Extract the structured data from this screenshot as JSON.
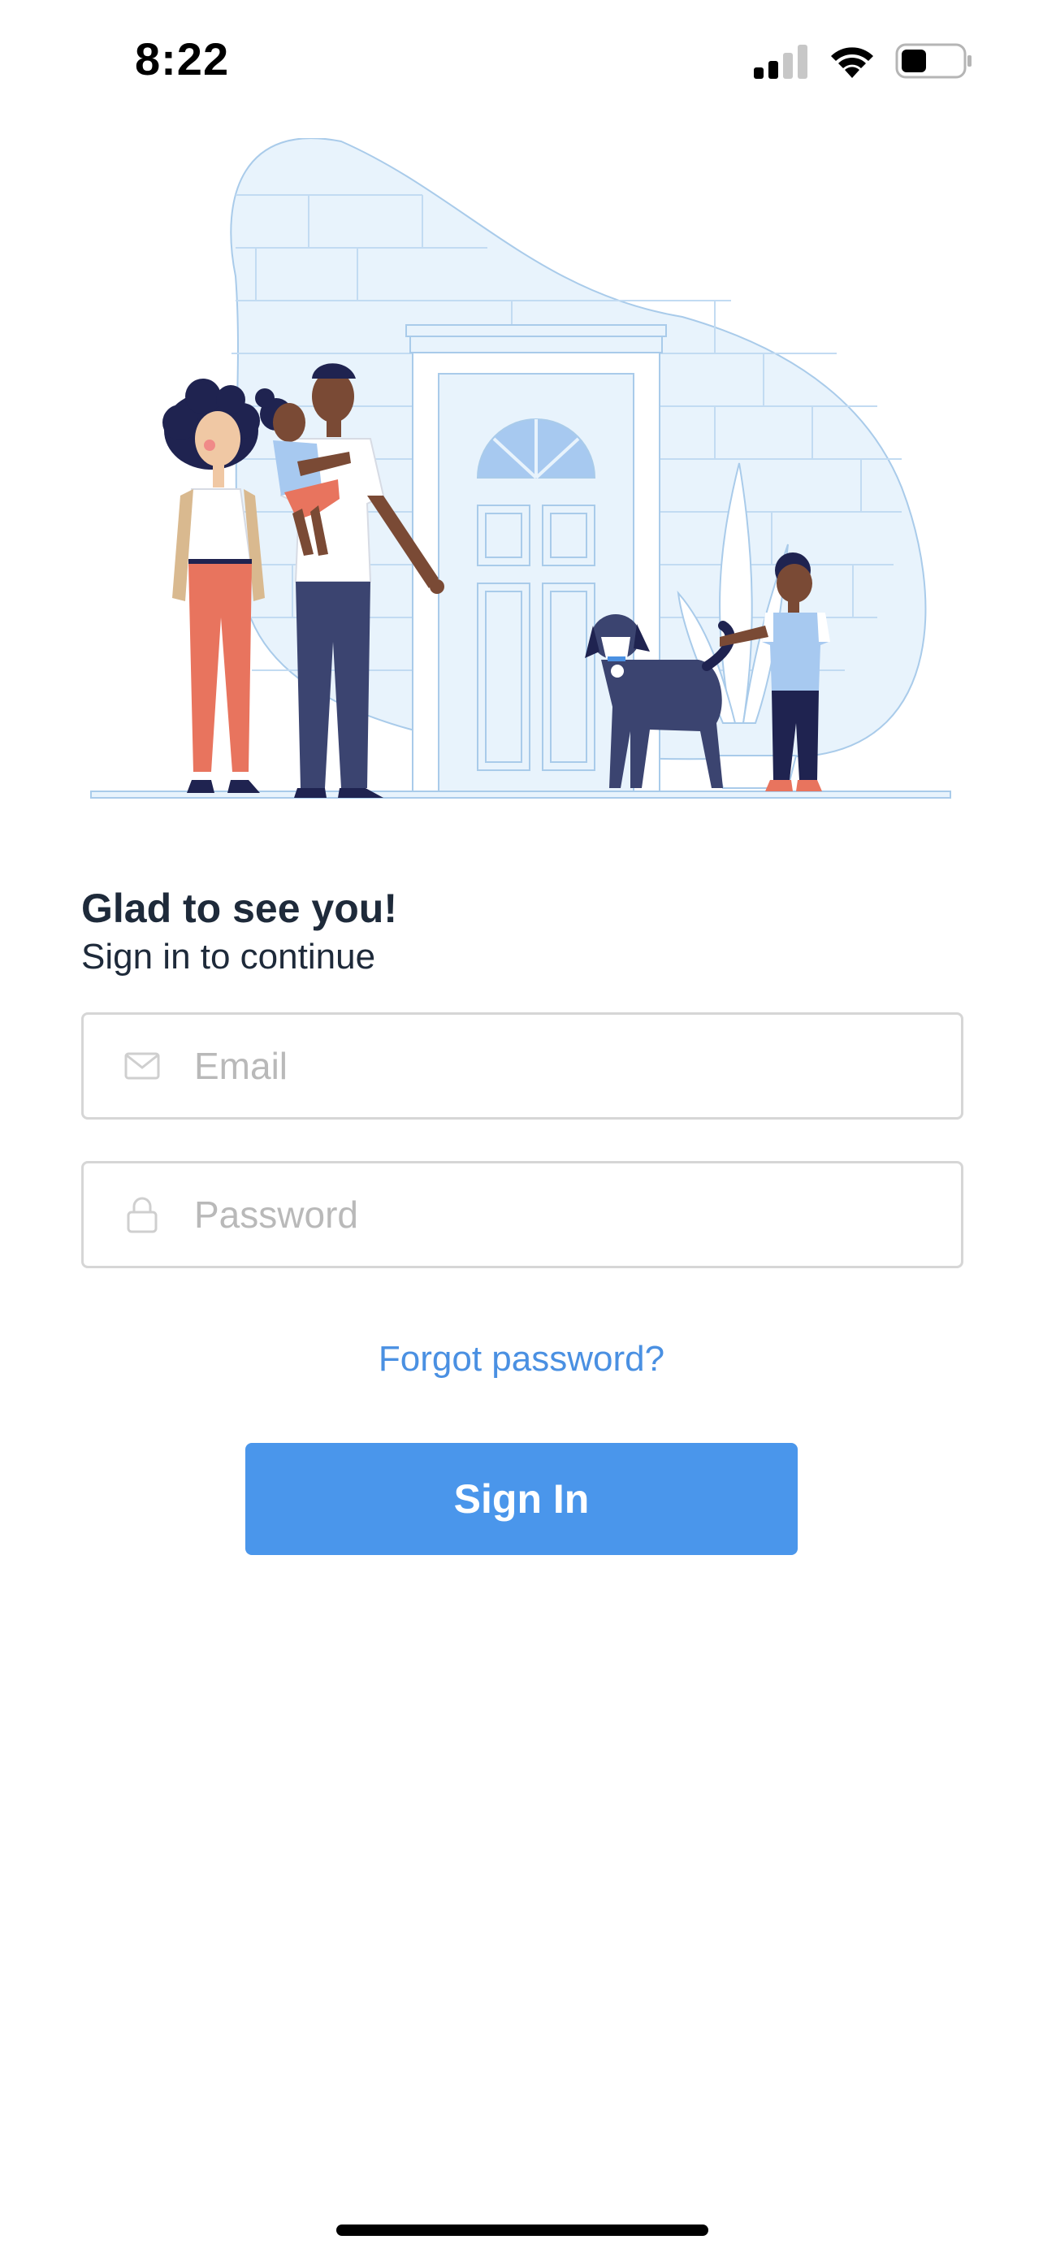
{
  "status_bar": {
    "time": "8:22",
    "icons": [
      "cellular-signal-icon",
      "wifi-icon",
      "battery-icon"
    ]
  },
  "illustration": {
    "subject": "family-at-front-door",
    "colors": {
      "wall": "#e8f3fc",
      "line": "#a9cbea",
      "door_window": "#a7c9f0",
      "pants_coral": "#e8745e",
      "navy": "#3b4470",
      "skin": "#7a4a35"
    }
  },
  "greeting": {
    "title": "Glad to see you!",
    "subtitle": "Sign in to continue"
  },
  "form": {
    "email": {
      "placeholder": "Email",
      "value": "",
      "icon": "mail-icon"
    },
    "password": {
      "placeholder": "Password",
      "value": "",
      "icon": "lock-icon"
    },
    "forgot_label": "Forgot password?",
    "submit_label": "Sign In"
  },
  "colors": {
    "accent": "#4a96eb",
    "link": "#4a90e2",
    "text": "#1e2a3a",
    "field_border": "#d6d6d6",
    "placeholder": "#b9b9b9"
  }
}
